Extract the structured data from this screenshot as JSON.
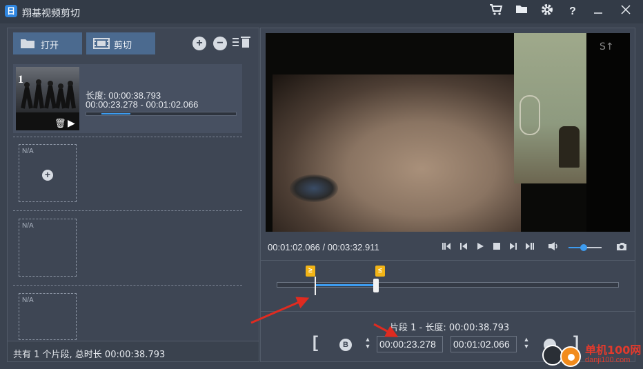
{
  "window": {
    "app_icon_glyph": "日",
    "title": "翔基视频剪切",
    "buttons": [
      "cart-icon",
      "folder-icon",
      "gear-icon",
      "help-icon",
      "minimize-icon",
      "close-icon"
    ]
  },
  "toolbar": {
    "open_label": "打开",
    "cut_label": "剪切"
  },
  "clips": [
    {
      "number": "1",
      "length": "长度: 00:00:38.793",
      "range": "00:00:23.278  -  00:01:02.066",
      "bar_selection": [
        0.1,
        0.29
      ]
    }
  ],
  "empty_slot_label": "N/A",
  "left_status": "共有 1 个片段, 总时长 00:00:38.793",
  "player": {
    "video_logo": "S↑",
    "time_readout": "00:01:02.066 / 00:03:32.911",
    "volume": 0.45
  },
  "timeline": {
    "selection": [
      0.11,
      0.29
    ],
    "start_flag": "≥",
    "end_flag": "≤"
  },
  "segment": {
    "info": "片段 1 - 长度: 00:00:38.793",
    "open_bracket": "[",
    "close_bracket": "]",
    "b_label": "B",
    "start_time": "00:00:23.278",
    "end_time": "00:01:02.066"
  },
  "watermark": {
    "text": "单机100网",
    "url": "danji100.com"
  },
  "colors": {
    "accent": "#3d9cf0",
    "flag": "#f2b416",
    "annotation_arrow": "#e02b20"
  }
}
